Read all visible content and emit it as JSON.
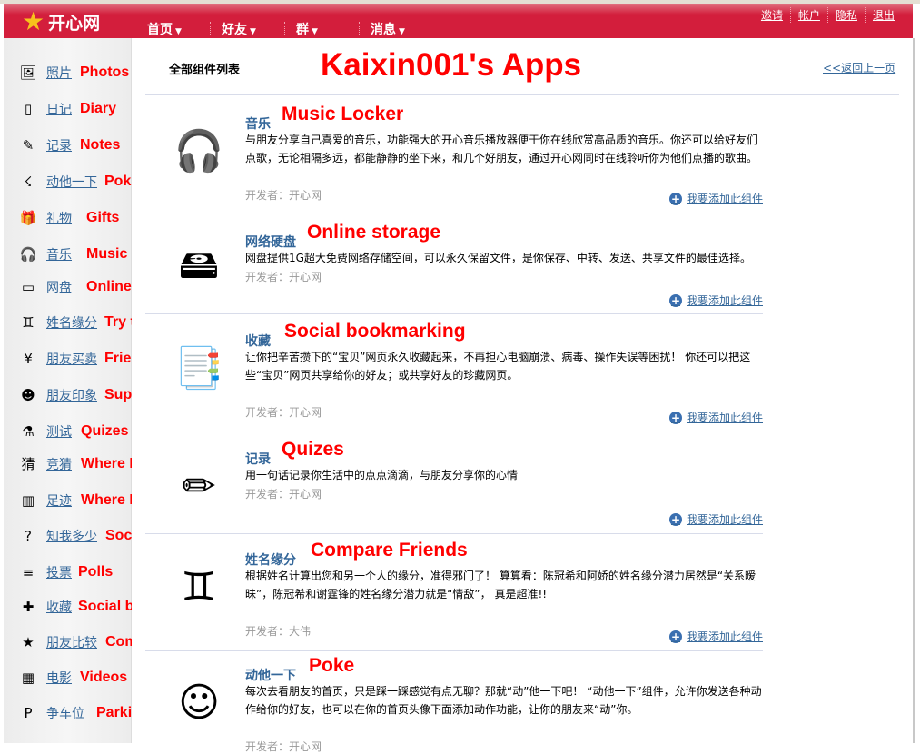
{
  "header": {
    "logo": "开心网",
    "nav": [
      "首页",
      "好友",
      "群",
      "消息"
    ],
    "links": [
      "邀请",
      "帐户",
      "隐私",
      "退出"
    ]
  },
  "sidebar": [
    {
      "cn": "照片",
      "en": "Photos",
      "icon": "photo-icon"
    },
    {
      "cn": "日记",
      "en": "Diary",
      "icon": "diary-icon"
    },
    {
      "cn": "记录",
      "en": "Notes",
      "icon": "notes-icon"
    },
    {
      "cn": "动他一下",
      "en": "Poke",
      "icon": "poke-icon"
    },
    {
      "cn": "礼物",
      "en": "Gifts",
      "icon": "gift-icon"
    },
    {
      "cn": "音乐",
      "en": "Music locker",
      "icon": "headphones-icon"
    },
    {
      "cn": "网盘",
      "en": "Online storage",
      "icon": "drive-icon"
    },
    {
      "cn": "姓名缘分",
      "en": "Try to Guess",
      "icon": "people-icon"
    },
    {
      "cn": "朋友买卖",
      "en": "Friends for Sale",
      "icon": "money-icon"
    },
    {
      "cn": "朋友印象",
      "en": "Superlatives",
      "icon": "face-icon"
    },
    {
      "cn": "测试",
      "en": "Quizes",
      "icon": "flask-icon"
    },
    {
      "cn": "竞猜",
      "en": "Where I've Been",
      "icon": "guess-icon"
    },
    {
      "cn": "足迹",
      "en": "Where I've Been",
      "icon": "buildings-icon"
    },
    {
      "cn": "知我多少",
      "en": "Social Me",
      "icon": "question-person-icon"
    },
    {
      "cn": "投票",
      "en": "Polls",
      "icon": "poll-icon"
    },
    {
      "cn": "收藏",
      "en": "Social bookmarks",
      "icon": "bookmark-icon"
    },
    {
      "cn": "朋友比较",
      "en": "Compare People",
      "icon": "compare-icon"
    },
    {
      "cn": "电影",
      "en": "Videos",
      "icon": "film-icon"
    },
    {
      "cn": "争车位",
      "en": "Parking Wars!",
      "icon": "parking-icon"
    }
  ],
  "main": {
    "title": "全部组件列表",
    "annotation": "Kaixin001's Apps",
    "back": "<<返回上一页",
    "add_label": "我要添加此组件",
    "apps": [
      {
        "title": "音乐",
        "ann": "Music Locker",
        "desc": "与朋友分享自己喜爱的音乐，功能强大的开心音乐播放器便于你在线欣赏高品质的音乐。你还可以给好友们点歌，无论相隔多远，都能静静的坐下来，和几个好朋友，通过开心网同时在线聆听你为他们点播的歌曲。",
        "dev": "开发者：开心网"
      },
      {
        "title": "网络硬盘",
        "ann": "Online storage",
        "desc": "网盘提供1G超大免费网络存储空间，可以永久保留文件，是你保存、中转、发送、共享文件的最佳选择。",
        "dev": "开发者：开心网"
      },
      {
        "title": "收藏",
        "ann": "Social bookmarking",
        "desc": "让你把辛苦攒下的“宝贝”网页永久收藏起来，不再担心电脑崩溃、病毒、操作失误等困扰！ 你还可以把这些“宝贝”网页共享给你的好友；或共享好友的珍藏网页。",
        "dev": "开发者：开心网"
      },
      {
        "title": "记录",
        "ann": "Quizes",
        "desc": "用一句话记录你生活中的点点滴滴，与朋友分享你的心情",
        "dev": "开发者：开心网"
      },
      {
        "title": "姓名缘分",
        "ann": "Compare Friends",
        "desc": "根据姓名计算出您和另一个人的缘分，准得邪门了！ 算算看：陈冠希和阿娇的姓名缘分潜力居然是“关系暧昧”，陈冠希和谢霆锋的姓名缘分潜力就是“情敌”， 真是超准!!",
        "dev": "开发者：大伟"
      },
      {
        "title": "动他一下",
        "ann": "Poke",
        "desc": "每次去看朋友的首页，只是踩一踩感觉有点无聊？那就“动”他一下吧！ “动他一下”组件，允许你发送各种动作给你的好友，也可以在你的首页头像下面添加动作功能，让你的朋友来“动”你。",
        "dev": "开发者：开心网"
      }
    ]
  }
}
